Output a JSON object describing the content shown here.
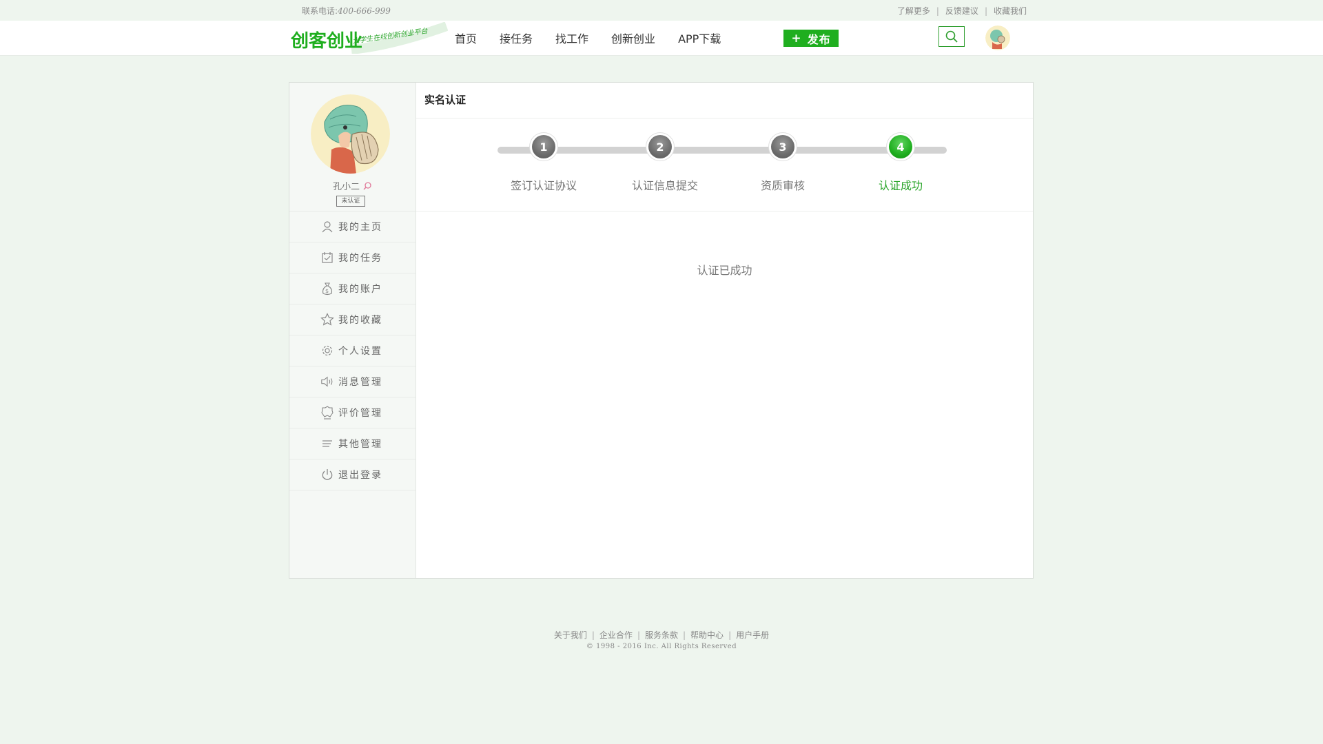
{
  "topbar": {
    "phone_label": "联系电话:",
    "phone_number": "400-666-999",
    "links": [
      "了解更多",
      "反馈建议",
      "收藏我们"
    ]
  },
  "header": {
    "logo_text": "创客创业",
    "logo_slogan": "大学生在线创新创业平台",
    "nav": [
      "首页",
      "接任务",
      "找工作",
      "创新创业",
      "APP下载"
    ],
    "publish_label": "发布",
    "publish_icon": "plus-icon",
    "search_icon": "search-icon",
    "accent_color": "#1fae1f"
  },
  "sidebar": {
    "username": "孔小二",
    "badge": "未认证",
    "items": [
      {
        "label": "我的主页",
        "icon": "user-icon"
      },
      {
        "label": "我的任务",
        "icon": "task-icon"
      },
      {
        "label": "我的账户",
        "icon": "money-bag-icon"
      },
      {
        "label": "我的收藏",
        "icon": "star-icon"
      },
      {
        "label": "个人设置",
        "icon": "gear-icon"
      },
      {
        "label": "消息管理",
        "icon": "speaker-icon"
      },
      {
        "label": "评价管理",
        "icon": "badge-icon"
      },
      {
        "label": "其他管理",
        "icon": "list-icon"
      },
      {
        "label": "退出登录",
        "icon": "power-icon"
      }
    ]
  },
  "content": {
    "title": "实名认证",
    "steps": [
      {
        "number": "1",
        "label": "签订认证协议",
        "active": false
      },
      {
        "number": "2",
        "label": "认证信息提交",
        "active": false
      },
      {
        "number": "3",
        "label": "资质审核",
        "active": false
      },
      {
        "number": "4",
        "label": "认证成功",
        "active": true
      }
    ],
    "message": "认证已成功"
  },
  "footer": {
    "links": [
      "关于我们",
      "企业合作",
      "服务条款",
      "帮助中心",
      "用户手册"
    ],
    "copyright": "© 1998 - 2016  Inc. All Rights Reserved"
  }
}
